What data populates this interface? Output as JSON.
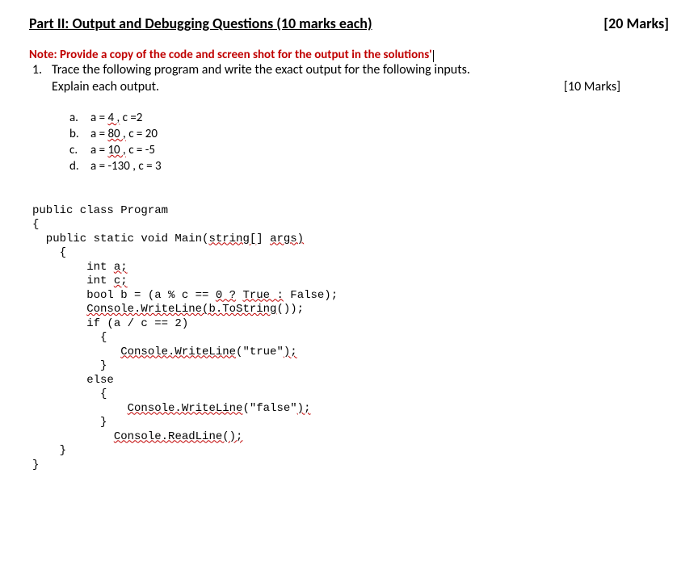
{
  "header": {
    "title": "Part II: Output and Debugging Questions (10 marks each)",
    "total_marks": "[20 Marks]"
  },
  "note": "Note: Provide a copy of the code and screen shot for the output in the solutions'",
  "question": {
    "number": "1.",
    "text": "Trace the following program and write the exact output for the following inputs.",
    "explain": "Explain each output.",
    "marks": "[10 Marks]"
  },
  "subs": {
    "a": {
      "letter": "a.",
      "pre": "a = ",
      "val1": "4 ,",
      "post": " c =2"
    },
    "b": {
      "letter": "b.",
      "pre": "a = ",
      "val1": "80 ,",
      "post": " c = 20"
    },
    "c": {
      "letter": "c.",
      "pre": "a = ",
      "val1": "10 ,",
      "post": " c = -5"
    },
    "d": {
      "letter": "d.",
      "text": "a = -130 , c = 3"
    }
  },
  "code": {
    "l1": "public class Program",
    "l2": "{",
    "l3a": "  public static void Main(",
    "l3b": "string[",
    "l3c": "] ",
    "l3d": "args)",
    "l4": "    {",
    "l5a": "        int ",
    "l5b": "a;",
    "l6a": "        int ",
    "l6b": "c;",
    "l7a": "        bool b = (a % c == ",
    "l7b": "0 ?",
    "l7c": " ",
    "l7d": "True :",
    "l7e": " False);",
    "l8a": "        ",
    "l8b": "Console.WriteLine(b.ToString",
    "l8c": "());",
    "l9": "        if (a / c == 2)",
    "l10": "          {",
    "l11a": "             ",
    "l11b": "Console.WriteLine",
    "l11c": "(\"true\"",
    "l11d": ");",
    "l12": "          }",
    "l13": "        else",
    "l14": "          {",
    "l15a": "              ",
    "l15b": "Console.WriteLine",
    "l15c": "(\"false\"",
    "l15d": ");",
    "l16": "          }",
    "l17a": "            ",
    "l17b": "Console.ReadLine();",
    "l18": "    }",
    "l19": "}"
  }
}
